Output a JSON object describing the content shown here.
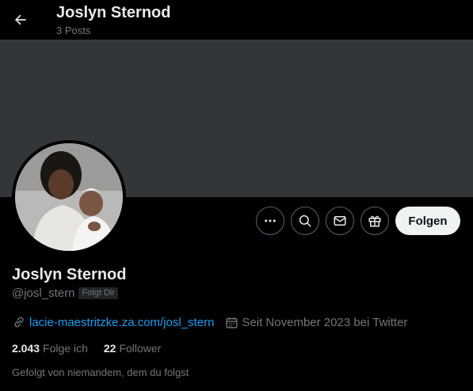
{
  "header": {
    "title": "Joslyn Sternod",
    "posts_count": "3 Posts"
  },
  "actions": {
    "more_icon": "more-icon",
    "search_icon": "search-icon",
    "message_icon": "mail-icon",
    "gift_icon": "gift-icon",
    "follow_label": "Folgen"
  },
  "profile": {
    "name": "Joslyn Sternod",
    "handle": "@josl_stern",
    "follows_you_badge": "Folgt Dir",
    "website": "lacie-maestritzke.za.com/josl_stern",
    "joined": "Seit November 2023 bei Twitter",
    "following_count": "2.043",
    "following_label": "Folge ich",
    "followers_count": "22",
    "followers_label": "Follower",
    "followed_by": "Gefolgt von niemandem, dem du folgst"
  },
  "colors": {
    "background": "#000000",
    "banner": "#333639",
    "link": "#1d9bf0",
    "secondary_text": "#71767b",
    "button_bg": "#eff3f4"
  }
}
